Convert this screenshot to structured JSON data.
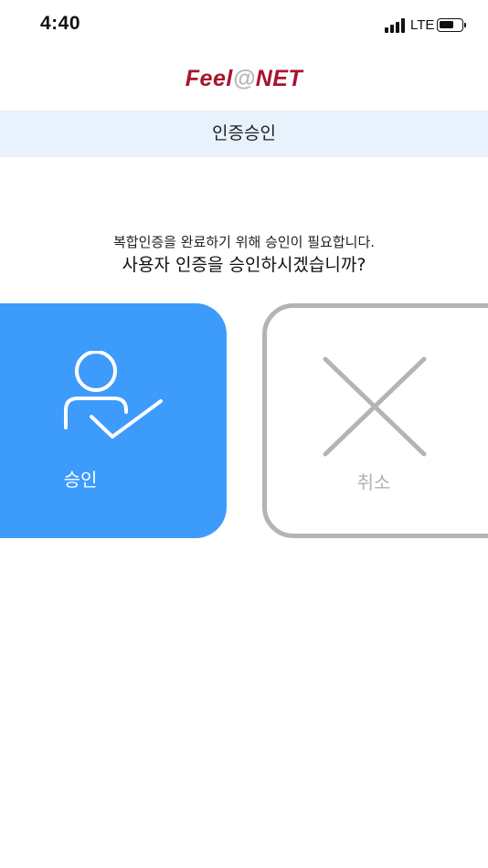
{
  "status_bar": {
    "time": "4:40",
    "network": "LTE",
    "battery_level": 0.7
  },
  "header": {
    "logo_part1": "Feel",
    "logo_at": "@",
    "logo_part2": "NET",
    "brand_color": "#a8152e"
  },
  "title_band": {
    "title": "인증승인",
    "background": "#e8f2fd"
  },
  "message": {
    "line1": "복합인증을 완료하기 위해 승인이 필요합니다.",
    "line2": "사용자 인증을 승인하시겠습니까?"
  },
  "actions": {
    "approve": {
      "label": "승인",
      "icon": "user-check-icon",
      "color": "#3d9bfc"
    },
    "cancel": {
      "label": "취소",
      "icon": "close-icon",
      "color": "#b4b4b4"
    }
  }
}
